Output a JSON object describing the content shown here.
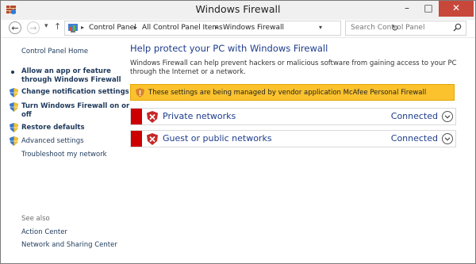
{
  "window": {
    "title": "Windows Firewall",
    "minimize": "–",
    "maximize": "□",
    "close": "✕"
  },
  "nav": {
    "back": "←",
    "forward": "→",
    "dropdown": "▾",
    "up": "↑",
    "breadcrumbs": [
      "Control Panel",
      "All Control Panel Items",
      "Windows Firewall"
    ],
    "refresh": "↻",
    "search_placeholder": "Search Control Panel"
  },
  "sidebar": {
    "home": "Control Panel Home",
    "items": [
      {
        "label_line1": "Allow an app or feature",
        "label_line2": "through Windows Firewall",
        "icon": "bullet"
      },
      {
        "label_line1": "Change notification settings",
        "icon": "shield-icon"
      },
      {
        "label_line1": "Turn Windows Firewall on or",
        "label_line2": "off",
        "icon": "shield-icon"
      },
      {
        "label_line1": "Restore defaults",
        "icon": "shield-icon"
      },
      {
        "label_line1": "Advanced settings",
        "icon": "shield-icon"
      },
      {
        "label_line1": "Troubleshoot my network",
        "icon": "none"
      }
    ],
    "see_also": {
      "heading": "See also",
      "links": [
        "Action Center",
        "Network and Sharing Center"
      ]
    }
  },
  "main": {
    "heading": "Help protect your PC with Windows Firewall",
    "description": "Windows Firewall can help prevent hackers or malicious software from gaining access to your PC through the Internet or a network.",
    "banner": {
      "text": "These settings are being managed by vendor application McAfee  Personal Firewall",
      "color": "#fbc22e"
    },
    "networks": [
      {
        "label": "Private networks",
        "status": "Connected",
        "icon": "shield-x-icon",
        "color": "#cc0000"
      },
      {
        "label": "Guest or public networks",
        "status": "Connected",
        "icon": "shield-x-icon",
        "color": "#cc0000"
      }
    ]
  },
  "colors": {
    "link": "#1e395b",
    "heading": "#1e3c8c",
    "alert": "#cc0000",
    "close": "#c7483b"
  }
}
